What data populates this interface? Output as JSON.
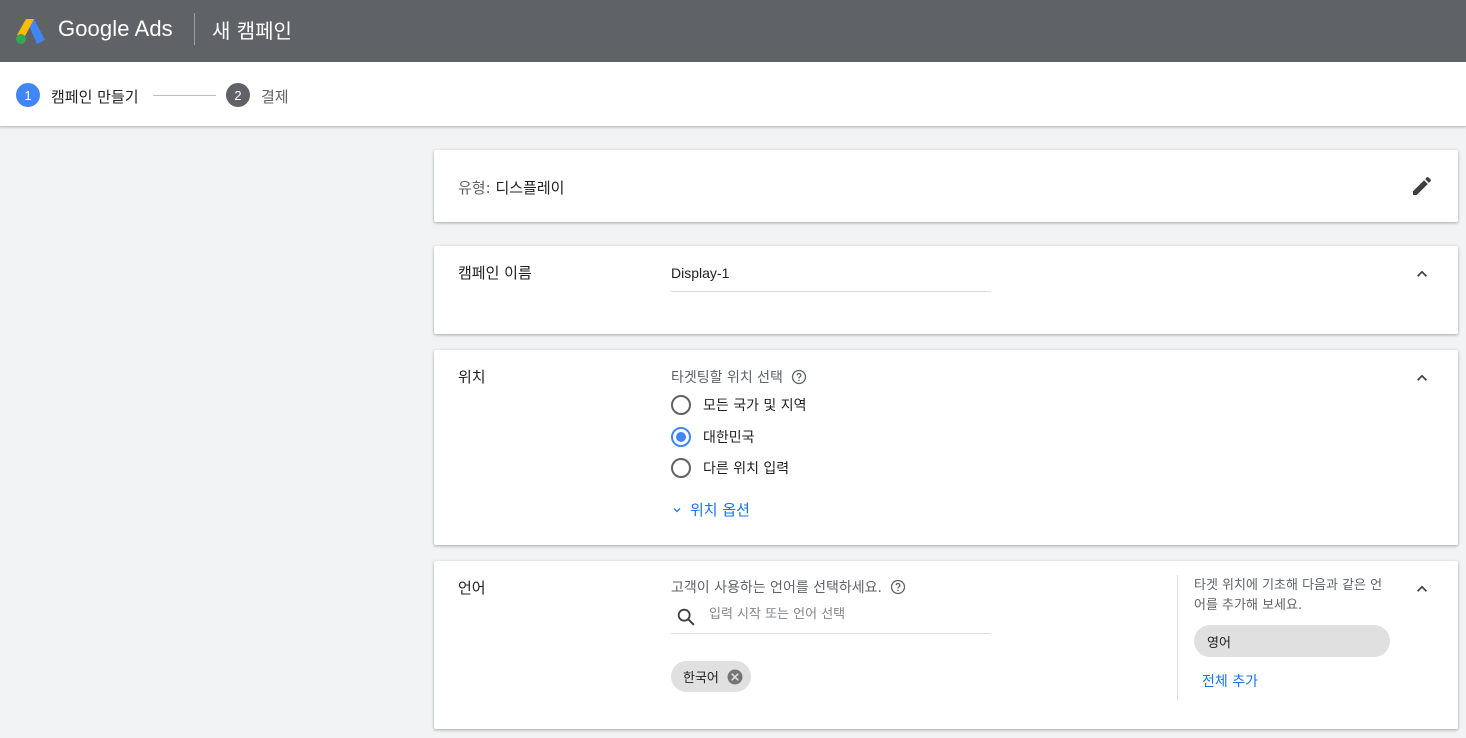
{
  "header": {
    "brand": "Google Ads",
    "page_title": "새 캠페인",
    "colors": {
      "bar": "#5f6368",
      "text": "#ffffff"
    }
  },
  "steps": [
    {
      "number": "1",
      "label": "캠페인 만들기",
      "active": true
    },
    {
      "number": "2",
      "label": "결제",
      "active": false
    }
  ],
  "type_card": {
    "key": "유형:",
    "value": "디스플레이",
    "edit_icon": "pencil-icon"
  },
  "name_card": {
    "label": "캠페인 이름",
    "value": "Display-1"
  },
  "location_card": {
    "label": "위치",
    "hint": "타겟팅할 위치 선택",
    "options": [
      {
        "label": "모든 국가 및 지역",
        "selected": false
      },
      {
        "label": "대한민국",
        "selected": true
      },
      {
        "label": "다른 위치 입력",
        "selected": false
      }
    ],
    "more_options": "위치 옵션"
  },
  "language_card": {
    "label": "언어",
    "hint": "고객이 사용하는 언어를 선택하세요.",
    "search_placeholder": "입력 시작 또는 언어 선택",
    "selected_chips": [
      "한국어"
    ],
    "suggestion_text": "타겟 위치에 기초해 다음과 같은 언어를 추가해 보세요.",
    "suggestions": [
      "영어"
    ],
    "add_all": "전체 추가"
  },
  "colors": {
    "accent": "#4285f4",
    "link": "#1a73e8",
    "background": "#f1f3f4"
  }
}
